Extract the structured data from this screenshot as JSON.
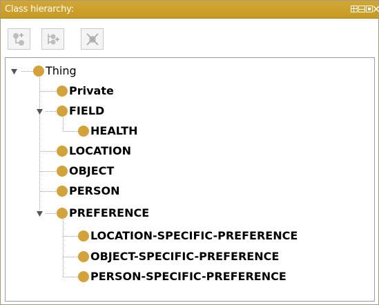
{
  "panel": {
    "title": "Class hierarchy:",
    "colors": {
      "titlebar": "#c9a02d",
      "class_ball": "#d4a23a"
    }
  },
  "toolbar": {
    "buttons": [
      {
        "icon": "add-subclass-icon",
        "enabled": false
      },
      {
        "icon": "add-sibling-class-icon",
        "enabled": false
      },
      {
        "icon": "delete-class-icon",
        "enabled": false
      }
    ]
  },
  "tree": {
    "root": {
      "label": "Thing",
      "expanded": true
    },
    "nodes": [
      {
        "label": "Private"
      },
      {
        "label": "FIELD",
        "expanded": true
      },
      {
        "label": "HEALTH"
      },
      {
        "label": "LOCATION"
      },
      {
        "label": "OBJECT"
      },
      {
        "label": "PERSON"
      },
      {
        "label": "PREFERENCE",
        "expanded": true
      },
      {
        "label": "LOCATION-SPECIFIC-PREFERENCE"
      },
      {
        "label": "OBJECT-SPECIFIC-PREFERENCE"
      },
      {
        "label": "PERSON-SPECIFIC-PREFERENCE"
      }
    ]
  }
}
